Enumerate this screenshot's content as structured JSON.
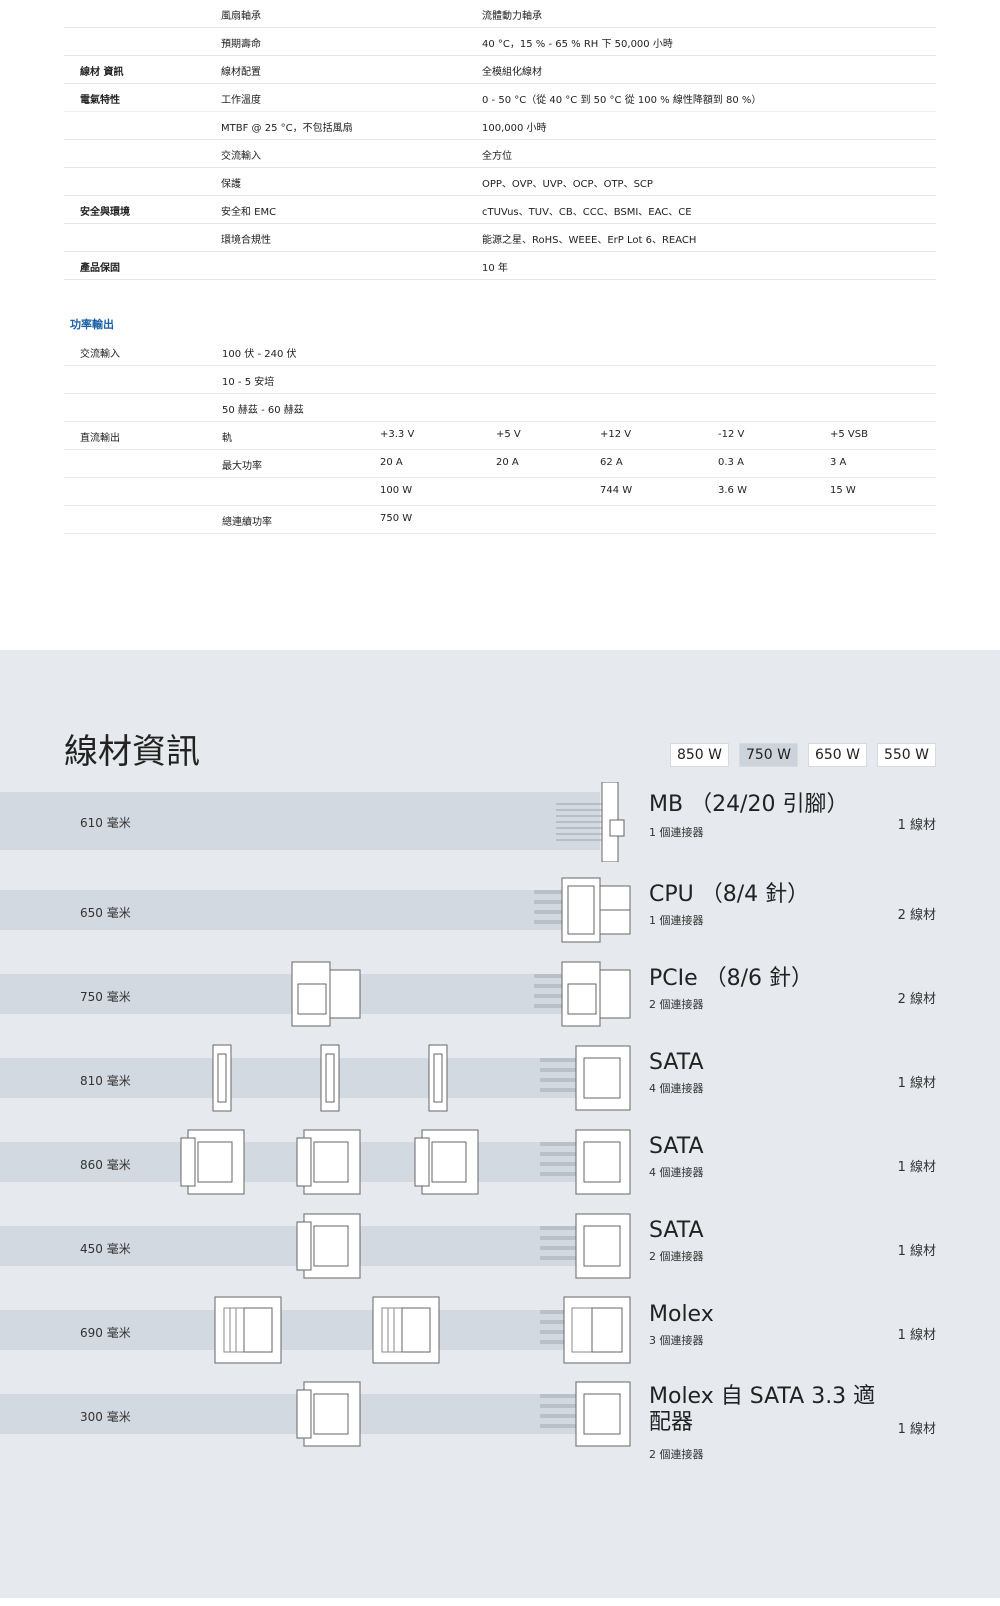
{
  "specs": [
    {
      "category": "",
      "label": "風扇軸承",
      "value": "流體動力軸承"
    },
    {
      "category": "",
      "label": "預期壽命",
      "value": "40 °C，15 % - 65 % RH 下 50,000 小時"
    },
    {
      "category": "線材 資訊",
      "label": "線材配置",
      "value": "全模組化線材"
    },
    {
      "category": "電氣特性",
      "label": "工作溫度",
      "value": "0 - 50 °C（從 40 °C 到 50 °C 從 100 % 線性降額到 80 %）"
    },
    {
      "category": "",
      "label": "MTBF @ 25 °C，不包括風扇",
      "value": "100,000 小時"
    },
    {
      "category": "",
      "label": "交流輸入",
      "value": "全方位"
    },
    {
      "category": "",
      "label": "保護",
      "value": "OPP、OVP、UVP、OCP、OTP、SCP"
    },
    {
      "category": "安全與環境",
      "label": "安全和 EMC",
      "value": "cTUVus、TUV、CB、CCC、BSMI、EAC、CE"
    },
    {
      "category": "",
      "label": "環境合規性",
      "value": "能源之星、RoHS、WEEE、ErP Lot 6、REACH"
    },
    {
      "category": "產品保固",
      "label": "",
      "value": "10 年"
    }
  ],
  "power": {
    "title": "功率輸出",
    "ac_label": "交流輸入",
    "ac_rows": [
      "100 伏 - 240 伏",
      "10 - 5 安培",
      "50 赫茲 - 60 赫茲"
    ],
    "dc_label": "直流輸出",
    "dc_rows": [
      {
        "label": "軌",
        "cells": [
          "+3.3 V",
          "+5 V",
          "+12 V",
          "-12 V",
          "+5 VSB"
        ]
      },
      {
        "label": "最大功率",
        "cells": [
          "20 A",
          "20 A",
          "62 A",
          "0.3 A",
          "3 A"
        ]
      },
      {
        "label": "",
        "cells": [
          "100 W",
          "",
          "744 W",
          "3.6 W",
          "15 W"
        ]
      },
      {
        "label": "總連續功率",
        "cells": [
          "750 W",
          "",
          "",
          "",
          ""
        ]
      }
    ]
  },
  "cables": {
    "title": "線材資訊",
    "tabs": [
      {
        "label": "850 W",
        "active": false
      },
      {
        "label": "750 W",
        "active": true
      },
      {
        "label": "650 W",
        "active": false
      },
      {
        "label": "550 W",
        "active": false
      }
    ],
    "items": [
      {
        "length": "610 毫米",
        "name": "MB （24/20 引腳）",
        "count": "1 個連接器",
        "qty": "1 線材"
      },
      {
        "length": "650 毫米",
        "name": "CPU （8/4 針）",
        "count": "1 個連接器",
        "qty": "2 線材"
      },
      {
        "length": "750 毫米",
        "name": "PCIe （8/6 針）",
        "count": "2 個連接器",
        "qty": "2 線材"
      },
      {
        "length": "810 毫米",
        "name": "SATA",
        "count": "4 個連接器",
        "qty": "1 線材"
      },
      {
        "length": "860 毫米",
        "name": "SATA",
        "count": "4 個連接器",
        "qty": "1 線材"
      },
      {
        "length": "450 毫米",
        "name": "SATA",
        "count": "2 個連接器",
        "qty": "1 線材"
      },
      {
        "length": "690 毫米",
        "name": "Molex",
        "count": "3 個連接器",
        "qty": "1 線材"
      },
      {
        "length": "300 毫米",
        "name": "Molex 自 SATA 3.3 適配器",
        "count": "2 個連接器",
        "qty": "1 線材"
      }
    ]
  },
  "colors": {
    "accent": "#1a5fa8",
    "panel": "#e6eaee",
    "band": "#d3d9e0"
  },
  "icons": [
    "mb-connector-icon",
    "cpu-connector-icon",
    "pcie-connector-icon",
    "sata-connector-icon",
    "molex-connector-icon"
  ]
}
